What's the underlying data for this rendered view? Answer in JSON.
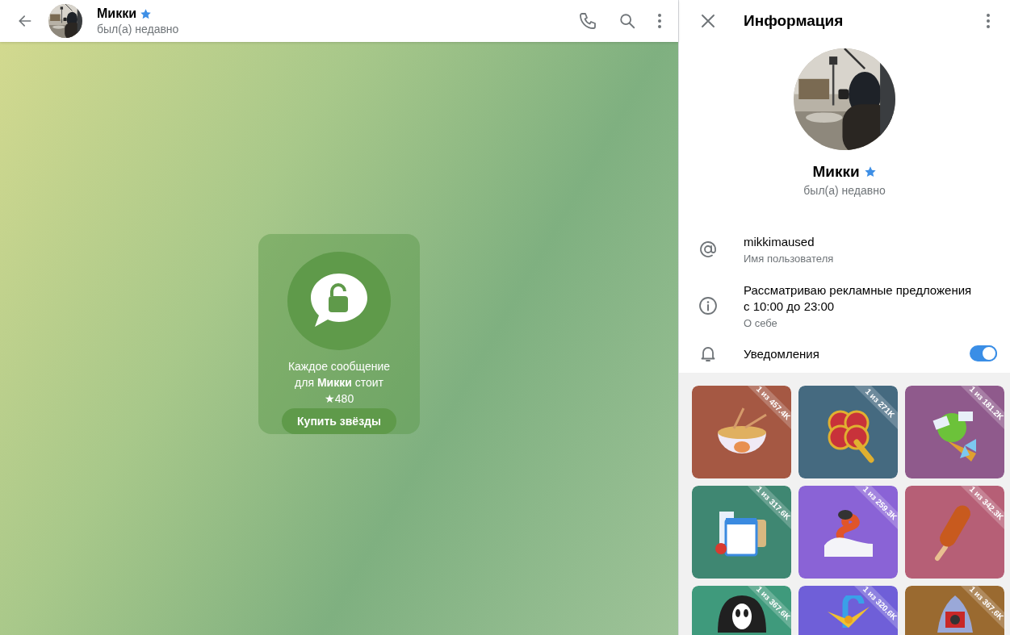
{
  "chat": {
    "header": {
      "name": "Микки",
      "status": "был(а) недавно"
    },
    "paid_message": {
      "text": "Каждое сообщение для **Микки** стоит ★480",
      "button": "Купить звёзды"
    }
  },
  "info": {
    "title": "Информация",
    "name": "Микки",
    "status": "был(а) недавно",
    "rows": [
      {
        "kind": "username",
        "value": "mikkimaused",
        "label": "Имя пользователя"
      },
      {
        "kind": "bio",
        "value": "Рассматриваю рекламные предложения с 10:00 до 23:00",
        "label": "О себе"
      }
    ],
    "notifications": {
      "label": "Уведомления",
      "on": true
    }
  },
  "gifts": [
    {
      "ribbon": "1 из 457.4K",
      "color": "#a55843"
    },
    {
      "ribbon": "1 из 271K",
      "color": "#456a80"
    },
    {
      "ribbon": "1 из 181.2K",
      "color": "#8f5a8c"
    },
    {
      "ribbon": "1 из 317.6K",
      "color": "#3f8772"
    },
    {
      "ribbon": "1 из 259.3K",
      "color": "#8a63d6"
    },
    {
      "ribbon": "1 из 342.3K",
      "color": "#b65f76"
    },
    {
      "ribbon": "1 из 367.6K",
      "color": "#3f9a7c"
    },
    {
      "ribbon": "1 из 320.6K",
      "color": "#6f5fd8"
    },
    {
      "ribbon": "1 из 367.6K",
      "color": "#9a6a30"
    }
  ]
}
